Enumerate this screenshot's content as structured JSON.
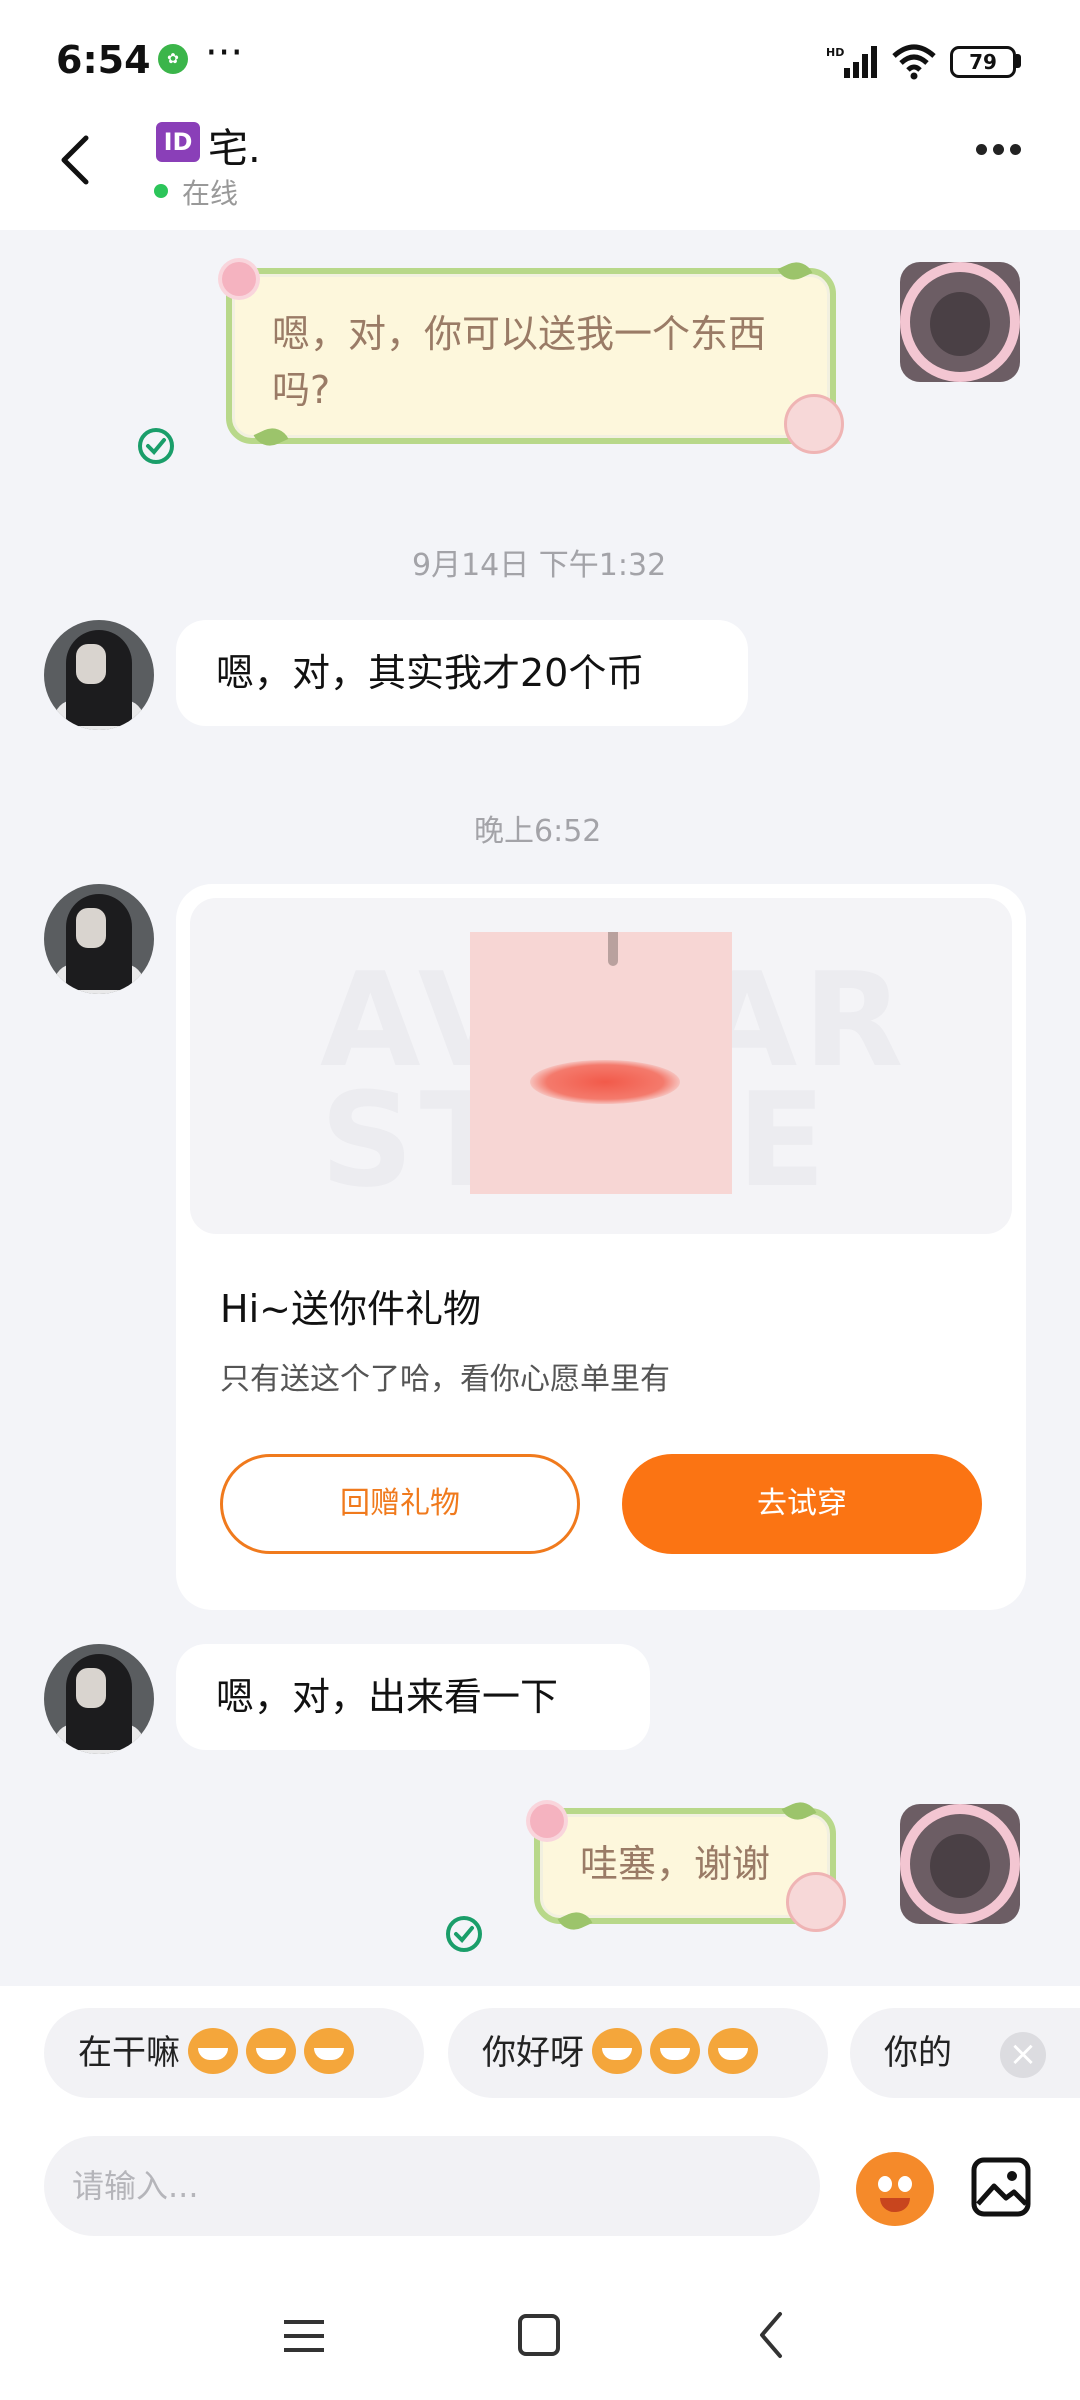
{
  "status_bar": {
    "time": "6:54",
    "battery": "79"
  },
  "header": {
    "name": "宅.",
    "id_badge": "ID",
    "status": "在线"
  },
  "messages": [
    {
      "type": "sent_deco",
      "text": "嗯，对，你可以送我一个东西吗?"
    },
    {
      "type": "timestamp",
      "text": "9月14日 下午1:32"
    },
    {
      "type": "received",
      "text": "嗯，对，其实我才20个币"
    },
    {
      "type": "timestamp",
      "text": "晚上6:52"
    },
    {
      "type": "gift_card",
      "watermark": "AVATAR STORE",
      "title": "Hi~送你件礼物",
      "subtitle": "只有送这个了哈，看你心愿单里有",
      "btn_return": "回赠礼物",
      "btn_try": "去试穿"
    },
    {
      "type": "received",
      "text": "嗯，对，出来看一下"
    },
    {
      "type": "sent_deco",
      "text": "哇塞，谢谢"
    }
  ],
  "quick_replies": [
    "在干嘛",
    "你好呀",
    "你的"
  ],
  "input": {
    "placeholder": "请输入..."
  },
  "colors": {
    "accent": "#fb7413",
    "online": "#2cc55a",
    "deco_border": "#b8d88a"
  }
}
